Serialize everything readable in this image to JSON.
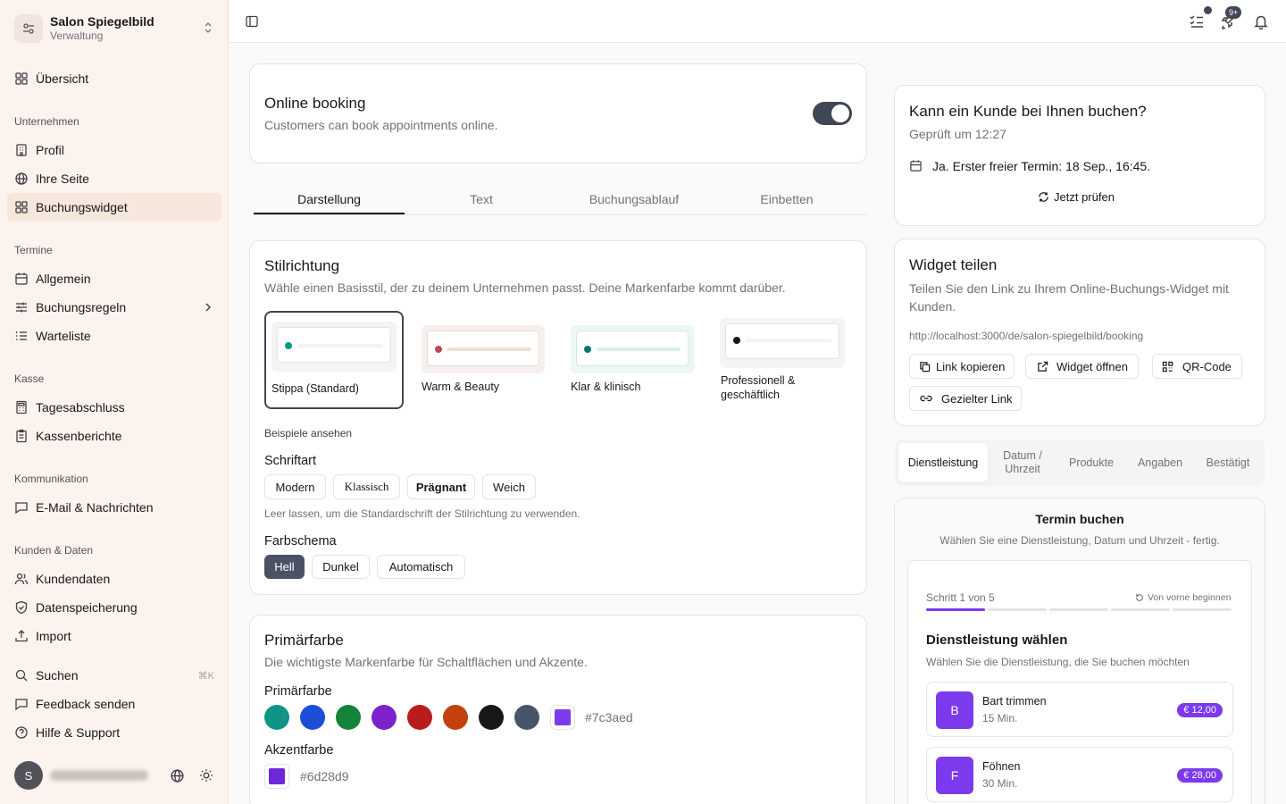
{
  "sidebar": {
    "org": {
      "name": "Salon Spiegelbild",
      "sub": "Verwaltung"
    },
    "overview": "Übersicht",
    "groups": {
      "company": "Unternehmen",
      "appointments": "Termine",
      "cash": "Kasse",
      "communication": "Kommunikation",
      "customers": "Kunden & Daten"
    },
    "items": {
      "profil": "Profil",
      "ihre_seite": "Ihre Seite",
      "buchungswidget": "Buchungswidget",
      "allgemein": "Allgemein",
      "buchungsregeln": "Buchungsregeln",
      "warteliste": "Warteliste",
      "tagesabschluss": "Tagesabschluss",
      "kassenberichte": "Kassenberichte",
      "email": "E-Mail & Nachrichten",
      "kundendaten": "Kundendaten",
      "datenspeicherung": "Datenspeicherung",
      "import": "Import",
      "suchen": "Suchen",
      "suchen_kbd": "⌘K",
      "feedback": "Feedback senden",
      "hilfe": "Hilfe & Support"
    },
    "user": {
      "initial": "S"
    }
  },
  "topbar": {
    "badge": "9+"
  },
  "online_booking": {
    "title": "Online booking",
    "desc": "Customers can book appointments online.",
    "enabled": true
  },
  "tabs": [
    "Darstellung",
    "Text",
    "Buchungsablauf",
    "Einbetten"
  ],
  "style": {
    "title": "Stilrichtung",
    "desc": "Wähle einen Basisstil, der zu deinem Unternehmen passt. Deine Markenfarbe kommt darüber.",
    "options": [
      "Stippa (Standard)",
      "Warm & Beauty",
      "Klar & klinisch",
      "Professionell & geschäftlich"
    ],
    "examples": "Beispiele ansehen",
    "font_title": "Schriftart",
    "fonts": [
      "Modern",
      "Klassisch",
      "Prägnant",
      "Weich"
    ],
    "font_hint": "Leer lassen, um die Standardschrift der Stilrichtung zu verwenden.",
    "scheme_title": "Farbschema",
    "schemes": [
      "Hell",
      "Dunkel",
      "Automatisch"
    ]
  },
  "primary": {
    "title": "Primärfarbe",
    "desc": "Die wichtigste Markenfarbe für Schaltflächen und Akzente.",
    "label": "Primärfarbe",
    "swatches": [
      "#0f9488",
      "#1d4ed8",
      "#16833a",
      "#7e22ce",
      "#b91c1c",
      "#c2410c",
      "#18181b",
      "#475569"
    ],
    "value": "#7c3aed",
    "accent_label": "Akzentfarbe",
    "accent_value": "#6d28d9"
  },
  "check": {
    "title": "Kann ein Kunde bei Ihnen buchen?",
    "checked": "Geprüft um 12:27",
    "result": "Ja. Erster freier Termin: 18 Sep., 16:45.",
    "button": "Jetzt prüfen"
  },
  "share": {
    "title": "Widget teilen",
    "desc": "Teilen Sie den Link zu Ihrem Online-Buchungs-Widget mit Kunden.",
    "url": "http://localhost:3000/de/salon-spiegelbild/booking",
    "copy": "Link kopieren",
    "open": "Widget öffnen",
    "qr": "QR-Code",
    "targeted": "Gezielter Link"
  },
  "preview_tabs": [
    "Dienstleistung",
    "Datum / Uhrzeit",
    "Produkte",
    "Angaben",
    "Bestätigt"
  ],
  "preview": {
    "title": "Termin buchen",
    "subtitle": "Wählen Sie eine Dienstleistung, Datum und Uhrzeit - fertig.",
    "step": "Schritt 1 von 5",
    "restart": "Von vorne beginnen",
    "step_progress": 0.2,
    "heading": "Dienstleistung wählen",
    "hint": "Wählen Sie die Dienstleistung, die Sie buchen möchten",
    "services": [
      {
        "initial": "B",
        "name": "Bart trimmen",
        "duration": "15 Min.",
        "price": "€ 12,00"
      },
      {
        "initial": "F",
        "name": "Föhnen",
        "duration": "30 Min.",
        "price": "€ 28,00"
      }
    ]
  }
}
